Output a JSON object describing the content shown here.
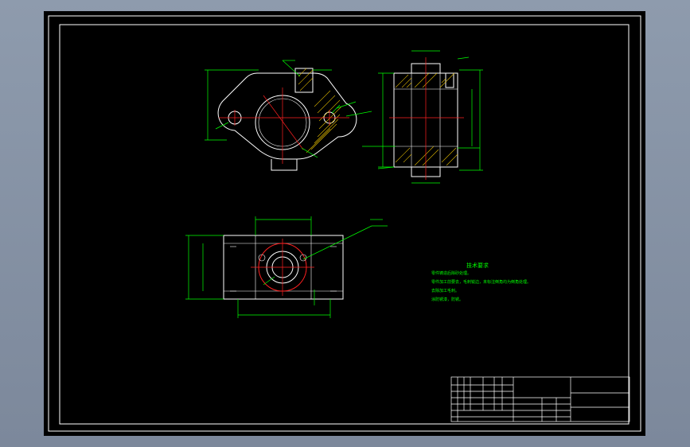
{
  "notes": {
    "title": "技术要求",
    "lines": [
      "零件铸造后除砂处理。",
      "零件加工前要去，毛刺锐边，未标注倒角均为倒角处理。",
      "去除加工毛刺。",
      "涂防锈漆，防锈。"
    ]
  },
  "colors": {
    "background": "#000000",
    "outline": "#ffffff",
    "dimension": "#00ff00",
    "center_line": "#ff2020",
    "hatch": "#d9b300",
    "frame": "#ffffff"
  }
}
